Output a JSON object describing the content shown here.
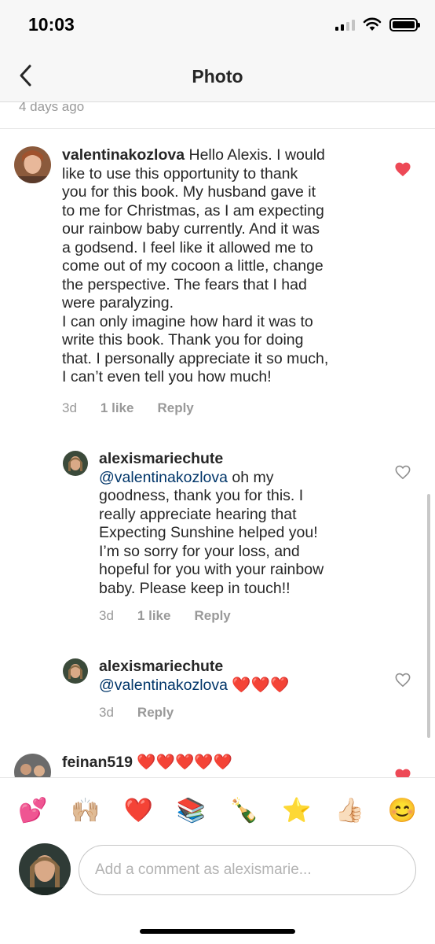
{
  "status": {
    "time": "10:03",
    "icons": [
      "signal-icon",
      "wifi-icon",
      "battery-icon"
    ]
  },
  "nav": {
    "title": "Photo",
    "back_icon": "chevron-left-icon"
  },
  "post": {
    "time_ago": "4 days ago"
  },
  "comments": [
    {
      "username": "valentinakozlova",
      "text_lines": [
        " Hello Alexis. I would",
        "like to use this opportunity to thank",
        "you for this book. My husband gave it",
        "to me for Christmas, as I am expecting",
        "our rainbow baby currently. And it was",
        "a godsend. I feel like it allowed me to",
        "come out of my cocoon a little, change",
        "the perspective. The fears that I had",
        "were paralyzing.",
        "I can only imagine how hard it was to",
        "write this book. Thank you for doing",
        "that. I personally appreciate it so much,",
        "I can’t even tell you how much!"
      ],
      "time": "3d",
      "likes": "1 like",
      "reply_label": "Reply",
      "liked": true
    },
    {
      "username": "alexismariechute",
      "mention": "@valentinakozlova",
      "text_lines": [
        " oh my",
        "goodness, thank you for this. I",
        "really appreciate hearing that",
        "Expecting Sunshine helped you!",
        "I’m so sorry for your loss, and",
        "hopeful for you with your rainbow",
        "baby. Please keep in touch!!"
      ],
      "time": "3d",
      "likes": "1 like",
      "reply_label": "Reply",
      "liked": false
    },
    {
      "username": "alexismariechute",
      "mention": "@valentinakozlova",
      "text": " ❤️❤️❤️",
      "time": "3d",
      "reply_label": "Reply",
      "liked": false
    },
    {
      "username": "feinan519",
      "text": " ❤️❤️❤️❤️❤️",
      "liked": true
    }
  ],
  "emoji_bar": [
    "💕",
    "🙌🏼",
    "❤️",
    "📚",
    "🍾",
    "⭐",
    "👍🏻",
    "😊"
  ],
  "composer": {
    "placeholder": "Add a comment as alexismarie..."
  },
  "colors": {
    "heart_liked": "#ed4956",
    "heart_outline": "#8e8e8e",
    "mention": "#003569",
    "secondary_text": "#999999"
  }
}
